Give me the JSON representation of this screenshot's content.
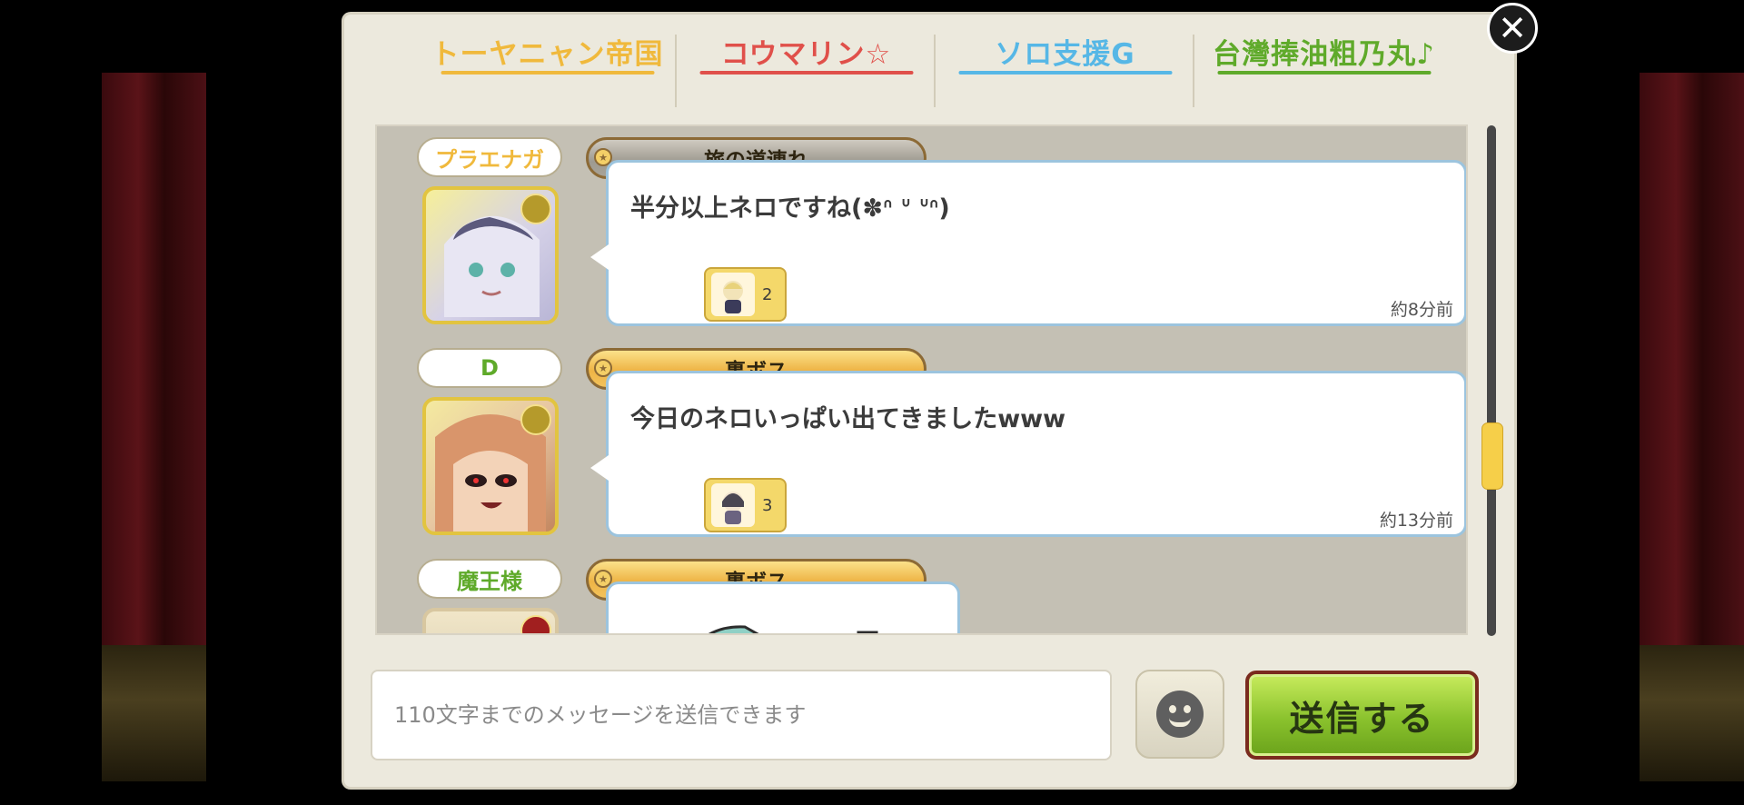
{
  "tabs": [
    {
      "label": "トーヤニャン帝国",
      "color": "#f0b93c"
    },
    {
      "label": "コウマリン☆",
      "color": "#e0504a"
    },
    {
      "label": "ソロ支援G",
      "color": "#56b7e6"
    },
    {
      "label": "台灣捧油粗乃丸♪",
      "color": "#5faa2a"
    }
  ],
  "messages": [
    {
      "name": "プラエナガ",
      "name_color": "#f0b93c",
      "title": "旅の道連れ",
      "title_style": "gray",
      "text": "半分以上ネロですね(✽ᐢ ᐡ ᐡᐢ)",
      "reaction_count": "2",
      "time": "約8分前"
    },
    {
      "name": "D",
      "name_color": "#5faa2a",
      "title": "裏ボス",
      "title_style": "gold",
      "text": "今日のネロいっぱい出てきましたwww",
      "reaction_count": "3",
      "time": "約13分前"
    },
    {
      "name": "魔王様",
      "name_color": "#5faa2a",
      "title": "裏ボス",
      "title_style": "gold"
    }
  ],
  "input": {
    "placeholder": "110文字までのメッセージを送信できます",
    "value": ""
  },
  "send_button": {
    "label": "送信する"
  },
  "close_label": "✕",
  "emoji_icon": "face-icon"
}
